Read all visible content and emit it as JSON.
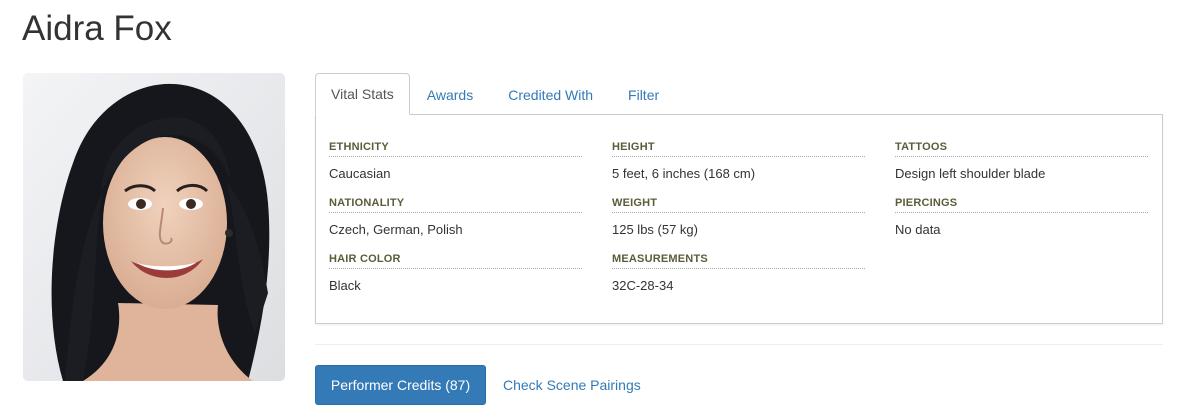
{
  "performer": {
    "name": "Aidra Fox",
    "photo_alt": "headshot"
  },
  "tabs": [
    {
      "label": "Vital Stats",
      "active": true
    },
    {
      "label": "Awards",
      "active": false
    },
    {
      "label": "Credited With",
      "active": false
    },
    {
      "label": "Filter",
      "active": false
    }
  ],
  "vital_stats": {
    "ethnicity": {
      "label": "ETHNICITY",
      "value": "Caucasian"
    },
    "nationality": {
      "label": "NATIONALITY",
      "value": "Czech, German, Polish"
    },
    "hair_color": {
      "label": "HAIR COLOR",
      "value": "Black"
    },
    "height": {
      "label": "HEIGHT",
      "value": "5 feet, 6 inches (168 cm)"
    },
    "weight": {
      "label": "WEIGHT",
      "value": "125 lbs (57 kg)"
    },
    "measurements": {
      "label": "MEASUREMENTS",
      "value": "32C-28-34"
    },
    "tattoos": {
      "label": "TATTOOS",
      "value": "Design left shoulder blade"
    },
    "piercings": {
      "label": "PIERCINGS",
      "value": "No data"
    }
  },
  "actions": {
    "credits_button": "Performer Credits (87)",
    "scene_pairings_link": "Check Scene Pairings"
  },
  "colors": {
    "link": "#337ab7",
    "primary_button": "#337ab7",
    "label": "#5c5c3a",
    "border": "#cccccc"
  }
}
